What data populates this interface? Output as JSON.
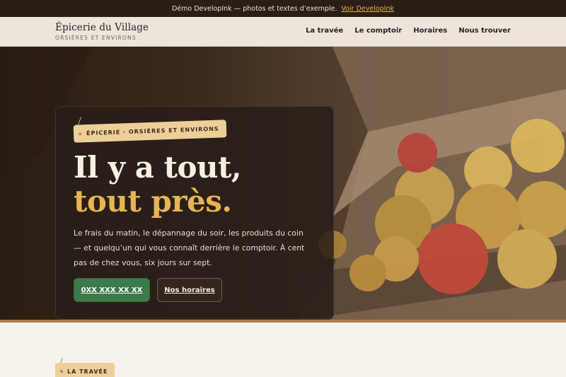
{
  "demo_bar": {
    "text": "Démo DevelopInk — photos et textes d’exemple.",
    "link_label": "Voir DevelopInk"
  },
  "header": {
    "brand_name": "Épicerie du Village",
    "brand_sub": "ORSIÈRES ET ENVIRONS",
    "nav": [
      "La travée",
      "Le comptoir",
      "Horaires",
      "Nous trouver"
    ]
  },
  "hero": {
    "tag": "ÉPICERIE · ORSIÈRES ET ENVIRONS",
    "headline_1": "Il y a tout,",
    "headline_2": "tout près.",
    "lead": "Le frais du matin, le dépannage du soir, les produits du coin — et quelqu’un qui vous connaît derrière le comptoir. À cent pas de chez vous, six jours sur sept.",
    "primary_button": "0XX XXX XX XX",
    "secondary_button": "Nos horaires"
  },
  "section": {
    "tag": "LA TRAVÉE"
  },
  "colors": {
    "accent_gold": "#e6b455",
    "tag_bg": "#eecf9a",
    "button_green": "#3c7a4c",
    "demo_bar_bg": "#2a1f16"
  }
}
